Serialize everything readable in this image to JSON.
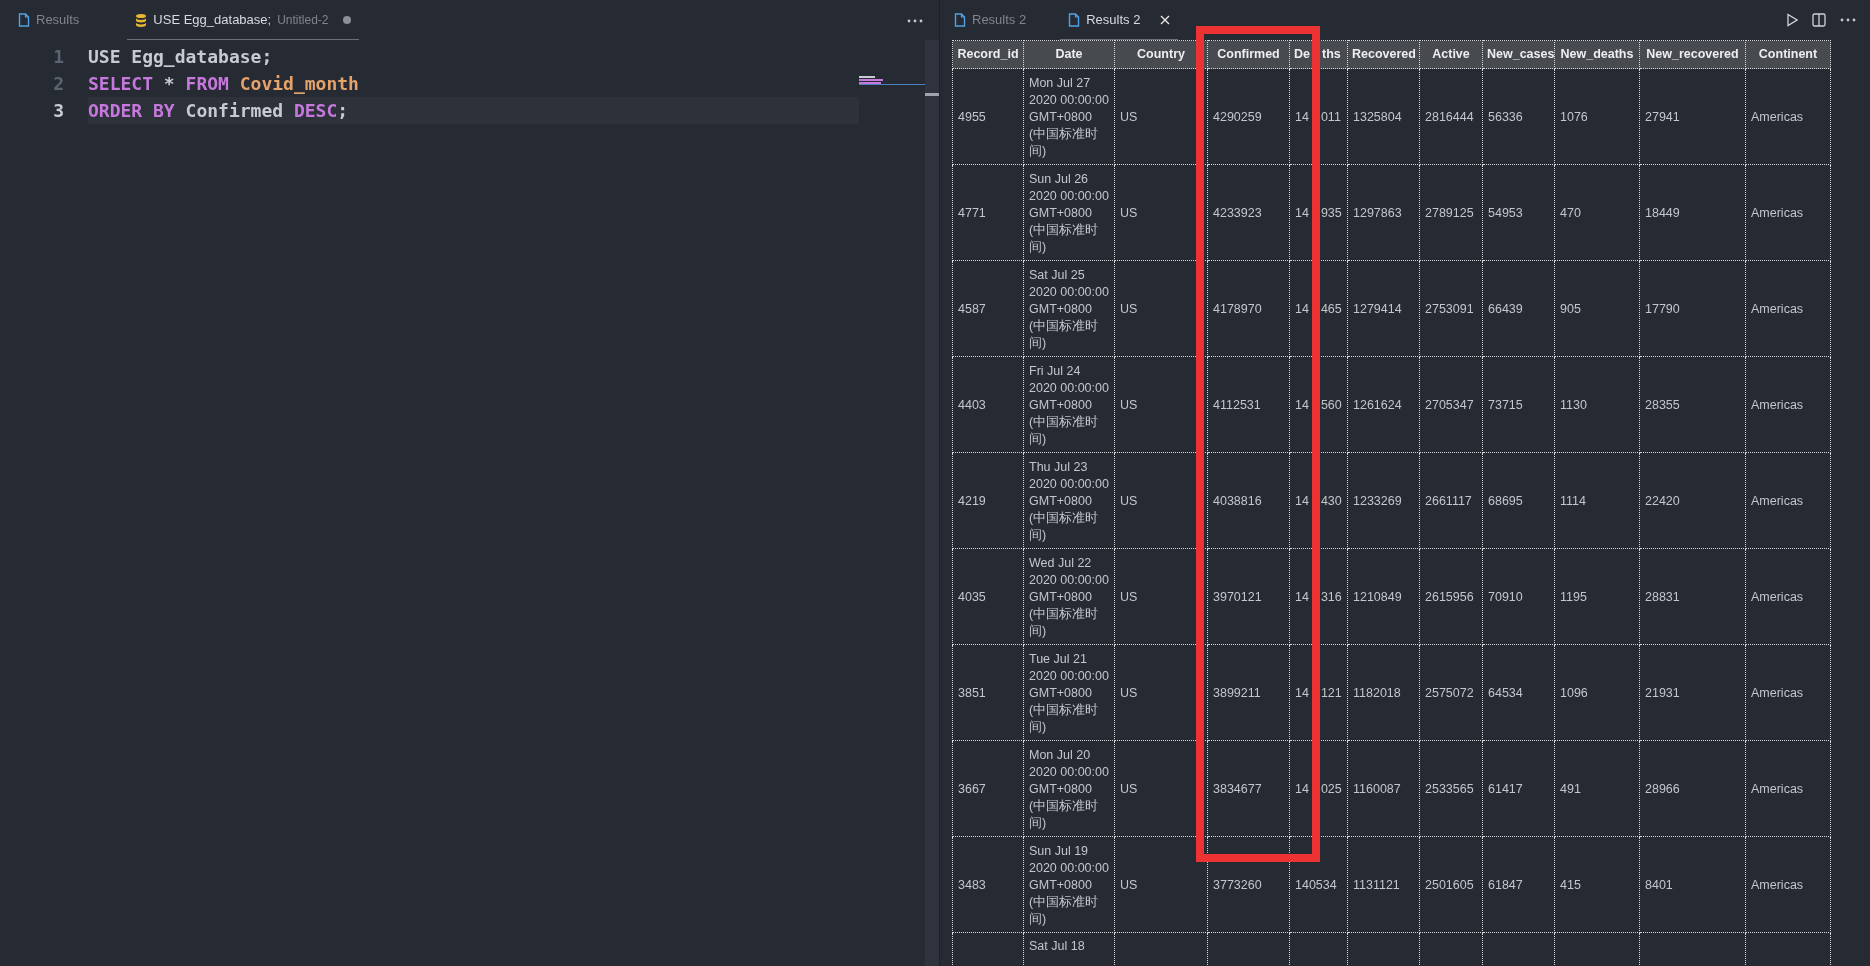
{
  "editor": {
    "tabs": [
      {
        "label": "Results",
        "selected": false
      },
      {
        "label": "USE Egg_database;",
        "description": "Untitled-2",
        "selected": true,
        "modified": true
      }
    ],
    "lines": [
      {
        "number": "1",
        "active": false,
        "tokens": [
          {
            "text": "USE Egg_database;",
            "kind": "plain"
          }
        ]
      },
      {
        "number": "2",
        "active": false,
        "tokens": [
          {
            "text": "SELECT",
            "kind": "keyword"
          },
          {
            "text": " * ",
            "kind": "plain"
          },
          {
            "text": "FROM ",
            "kind": "keyword"
          },
          {
            "text": "Covid_month",
            "kind": "identifier"
          }
        ]
      },
      {
        "number": "3",
        "active": true,
        "tokens": [
          {
            "text": "ORDER BY",
            "kind": "keyword"
          },
          {
            "text": " Confirmed ",
            "kind": "plain"
          },
          {
            "text": "DESC",
            "kind": "keyword"
          },
          {
            "text": ";",
            "kind": "plain"
          }
        ]
      }
    ]
  },
  "results": {
    "tabs": [
      {
        "label": "Results 2",
        "selected": false
      },
      {
        "label": "Results 2",
        "selected": true
      }
    ],
    "table": {
      "columns": [
        "Record_id",
        "Date",
        "Country",
        "Confirmed",
        {
          "parts": [
            "De",
            "ths"
          ]
        },
        "Recovered",
        "Active",
        "New_cases",
        "New_deaths",
        "New_recovered",
        "Continent"
      ],
      "rows": [
        [
          "4955",
          "Mon Jul 27 2020 00:00:00 GMT+0800 (中国标准时间)",
          "US",
          "4290259",
          {
            "parts": [
              "14",
              "011"
            ]
          },
          "1325804",
          "2816444",
          "56336",
          "1076",
          "27941",
          "Americas"
        ],
        [
          "4771",
          "Sun Jul 26 2020 00:00:00 GMT+0800 (中国标准时间)",
          "US",
          "4233923",
          {
            "parts": [
              "14",
              "935"
            ]
          },
          "1297863",
          "2789125",
          "54953",
          "470",
          "18449",
          "Americas"
        ],
        [
          "4587",
          "Sat Jul 25 2020 00:00:00 GMT+0800 (中国标准时间)",
          "US",
          "4178970",
          {
            "parts": [
              "14",
              "465"
            ]
          },
          "1279414",
          "2753091",
          "66439",
          "905",
          "17790",
          "Americas"
        ],
        [
          "4403",
          "Fri Jul 24 2020 00:00:00 GMT+0800 (中国标准时间)",
          "US",
          "4112531",
          {
            "parts": [
              "14",
              "560"
            ]
          },
          "1261624",
          "2705347",
          "73715",
          "1130",
          "28355",
          "Americas"
        ],
        [
          "4219",
          "Thu Jul 23 2020 00:00:00 GMT+0800 (中国标准时间)",
          "US",
          "4038816",
          {
            "parts": [
              "14",
              "430"
            ]
          },
          "1233269",
          "2661117",
          "68695",
          "1114",
          "22420",
          "Americas"
        ],
        [
          "4035",
          "Wed Jul 22 2020 00:00:00 GMT+0800 (中国标准时间)",
          "US",
          "3970121",
          {
            "parts": [
              "14",
              "316"
            ]
          },
          "1210849",
          "2615956",
          "70910",
          "1195",
          "28831",
          "Americas"
        ],
        [
          "3851",
          "Tue Jul 21 2020 00:00:00 GMT+0800 (中国标准时间)",
          "US",
          "3899211",
          {
            "parts": [
              "14",
              "121"
            ]
          },
          "1182018",
          "2575072",
          "64534",
          "1096",
          "21931",
          "Americas"
        ],
        [
          "3667",
          "Mon Jul 20 2020 00:00:00 GMT+0800 (中国标准时间)",
          "US",
          "3834677",
          {
            "parts": [
              "14",
              "025"
            ]
          },
          "1160087",
          "2533565",
          "61417",
          "491",
          "28966",
          "Americas"
        ],
        [
          "3483",
          "Sun Jul 19 2020 00:00:00 GMT+0800 (中国标准时间)",
          "US",
          "3773260",
          "140534",
          "1131121",
          "2501605",
          "61847",
          "415",
          "8401",
          "Americas"
        ],
        [
          null,
          "Sat Jul 18",
          null,
          null,
          null,
          null,
          null,
          null,
          null,
          null,
          null
        ]
      ]
    }
  }
}
